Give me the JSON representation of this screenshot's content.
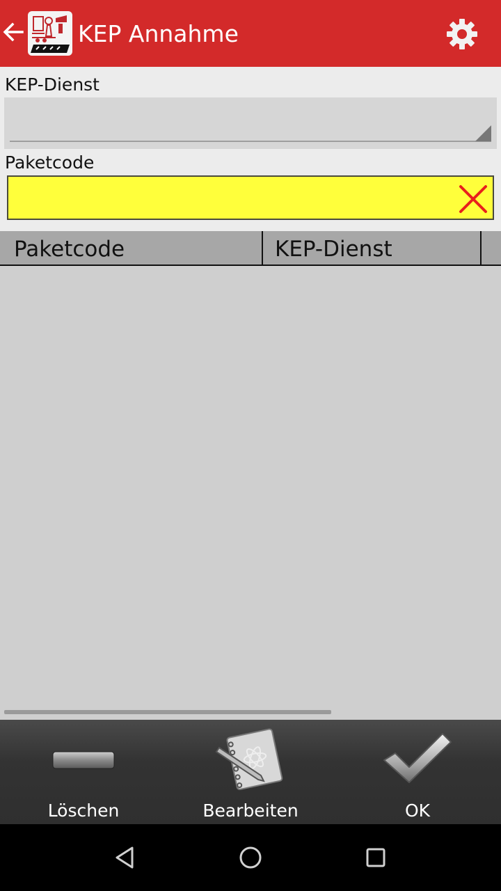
{
  "appbar": {
    "title": "KEP Annahme",
    "back_icon": "arrow-left-icon",
    "logo_icon": "app-logo-icon",
    "settings_icon": "gear-icon",
    "background": "#d32a2a"
  },
  "form": {
    "kep_dienst_label": "KEP-Dienst",
    "kep_dienst_value": "",
    "paketcode_label": "Paketcode",
    "paketcode_value": "",
    "paketcode_bg": "#ffff3b",
    "clear_icon": "close-x-icon"
  },
  "table": {
    "columns": [
      "Paketcode",
      "KEP-Dienst"
    ],
    "rows": []
  },
  "bottom": {
    "delete_label": "Löschen",
    "edit_label": "Bearbeiten",
    "ok_label": "OK"
  },
  "system_nav": {
    "icons": [
      "back-triangle-icon",
      "home-circle-icon",
      "recents-square-icon"
    ]
  }
}
